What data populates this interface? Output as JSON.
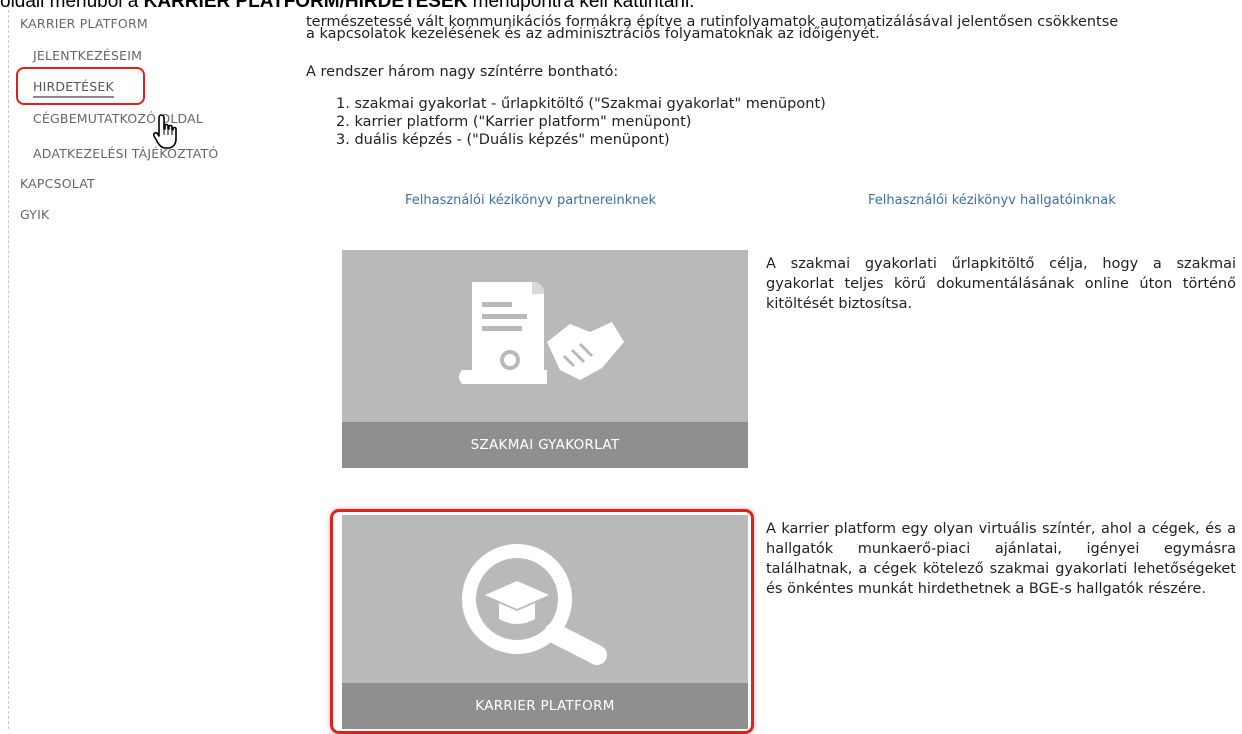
{
  "caption": {
    "prefix": "oldali menüből a ",
    "bold": "KARRIER PLATFORM/HIRDETÉSEK",
    "suffix": " menüpontra kell kattintani."
  },
  "sidebar": {
    "items": [
      {
        "label": "KARRIER PLATFORM"
      },
      {
        "label": "JELENTKEZÉSEIM"
      },
      {
        "label": "HIRDETÉSEK"
      },
      {
        "label": "CÉGBEMUTATKOZÓ OLDAL"
      },
      {
        "label": "ADATKEZELÉSI TÁJÉKOZTATÓ"
      },
      {
        "label": "KAPCSOLAT"
      },
      {
        "label": "GYIK"
      }
    ]
  },
  "main": {
    "intro_line1": "természetessé vált kommunikációs formákra építve a rutinfolyamatok automatizálásával jelentősen csökkentse",
    "intro_line2": "a kapcsolatok kezelésének és az adminisztrációs folyamatoknak az időigényét.",
    "areas_heading": "A rendszer három nagy színtérre bontható:",
    "areas": [
      "1. szakmai gyakorlat - űrlapkitöltő (\"Szakmai gyakorlat\" menüpont)",
      "2. karrier platform (\"Karrier platform\" menüpont)",
      "3. duális képzés - (\"Duális képzés\" menüpont)"
    ],
    "link_partners": "Felhasználói kézikönyv partnereinknek",
    "link_students": "Felhasználói kézikönyv hallgatóinknak",
    "tiles": [
      {
        "label": "SZAKMAI GYAKORLAT",
        "description": "A szakmai gyakorlati űrlapkitöltő célja, hogy a szakmai gyakorlat teljes körű dokumentálásának online úton történő kitöltését biztosítsa."
      },
      {
        "label": "KARRIER PLATFORM",
        "description": "A karrier platform egy olyan virtuális színtér, ahol a cégek, és a hallgatók munkaerő-piaci ajánlatai, igényei egymásra találhatnak, a cégek kötelező szakmai gyakorlati lehetőségeket és önkéntes munkát hirdethetnek a BGE-s hallgatók részére."
      }
    ]
  },
  "colors": {
    "highlight": "#e0201c",
    "tile_bg": "#b9b9b9",
    "tile_bar": "#8f8f8f",
    "link": "#3a6fa8"
  },
  "icons": [
    "document-handshake-icon",
    "magnifier-graduation-cap-icon",
    "hand-pointer-icon"
  ]
}
